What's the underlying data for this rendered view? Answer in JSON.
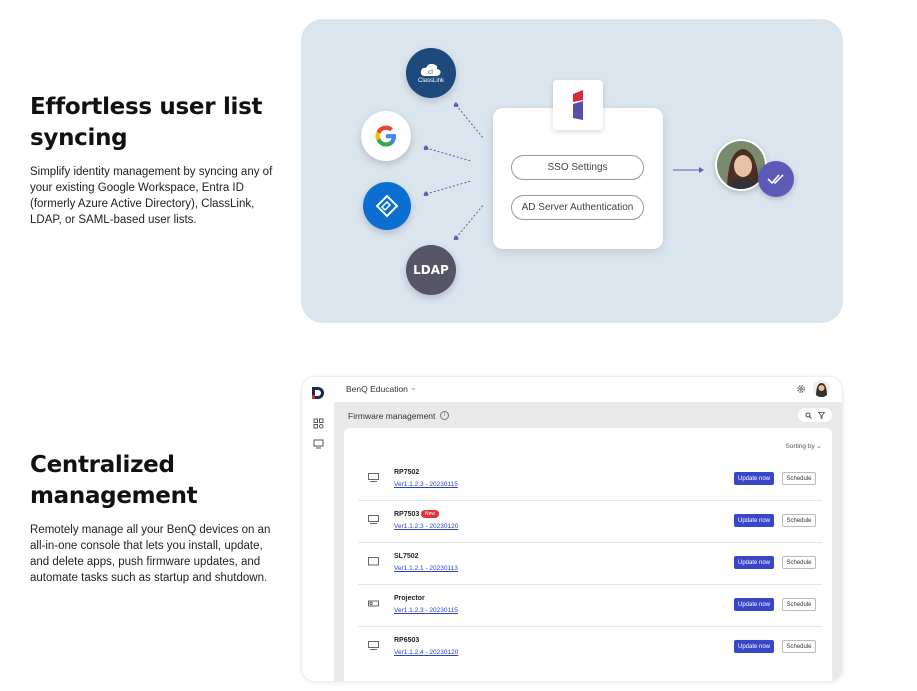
{
  "section1": {
    "title_line1": "Effortless user list",
    "title_line2": "syncing",
    "description": "Simplify identity management by syncing any of your existing Google Workspace, Entra ID (formerly Azure Active Directory), ClassLink, LDAP, or SAML-based user lists."
  },
  "sso": {
    "classlink_label": "ClassLink",
    "google_label": "G",
    "ldap_label": "LDAP",
    "pill1": "SSO Settings",
    "pill2": "AD Server Authentication"
  },
  "section2": {
    "title_line1": "Centralized",
    "title_line2": "management",
    "description": "Remotely manage all your BenQ devices on an all-in-one console that lets you install, update, and delete apps, push firmware updates, and automate tasks such as startup and shutdown."
  },
  "console": {
    "org_name": "BenQ Education",
    "page_title": "Firmware management",
    "sort_label": "Sorting by",
    "update_label": "Update now",
    "schedule_label": "Schedule",
    "new_badge": "New",
    "rows": [
      {
        "name": "RP7502",
        "version": "Ver1.1.2.3 - 20230115"
      },
      {
        "name": "RP7503",
        "version": "Ver1.1.2.3 - 20230120"
      },
      {
        "name": "SL7502",
        "version": "Ver1.1.2.1 - 20230113"
      },
      {
        "name": "Projector",
        "version": "Ver1.1.2.3 - 20230115"
      },
      {
        "name": "RP6503",
        "version": "Ver1.1.2.4 - 20230120"
      }
    ]
  },
  "colors": {
    "sso_bg": "#dbe5ee",
    "accent_blue": "#3a46c9",
    "new_red": "#e0323a",
    "ldap_gray": "#555566",
    "classlink_navy": "#1d4a7a"
  }
}
